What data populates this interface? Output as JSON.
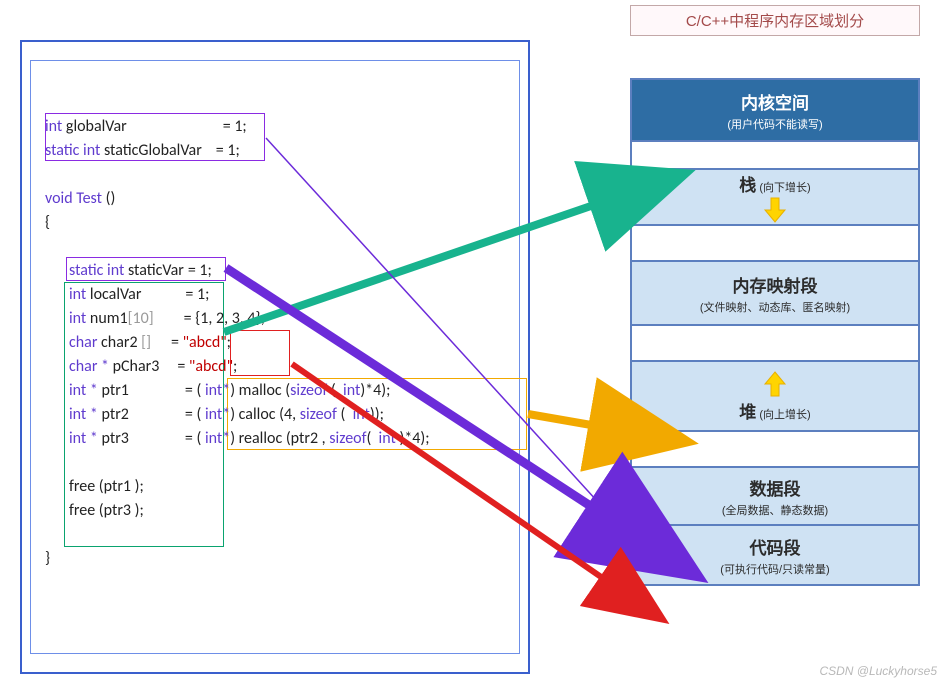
{
  "title": "C/C++中程序内存区域划分",
  "code": {
    "l1_kw": "int",
    "l1_txt": " globalVar",
    "l1_eq": "= 1;",
    "l2_kw": "static int",
    "l2_txt": " staticGlobalVar",
    "l2_eq": "= 1;",
    "l4_kw": "void",
    "l4_fn": "Test",
    "l4_paren": " ()",
    "l5": "{",
    "l6_kw": "static int",
    "l6_txt": " staticVar",
    "l6_eq": "= 1;",
    "l7_kw": "int",
    "l7_txt": " localVar",
    "l7_eq": "= 1;",
    "l8_kw": "int",
    "l8_txt": " num1",
    "l8_idx": "[10]",
    "l8_eq": "= {1, 2, 3, 4};",
    "l9_kw": "char",
    "l9_txt": " char2",
    "l9_idx": " []",
    "l9_eq": "= ",
    "l9_str": "\"abcd\"",
    "l9_sc": ";",
    "l10_kw": "char *",
    "l10_txt": " pChar3",
    "l10_eq": "= ",
    "l10_str": "\"abcd\"",
    "l10_sc": ";",
    "l11_kw": "int *",
    "l11_txt": " ptr1",
    "l11_eq": "= ( ",
    "l11_cast": "int*",
    "l11_call": ") malloc (",
    "l11_size": "sizeof",
    "l11_rest": " ( ",
    "l11_int": " int",
    "l11_p2": ")*4);",
    "l12_kw": "int *",
    "l12_txt": " ptr2",
    "l12_eq": "= ( ",
    "l12_cast": "int*",
    "l12_call": ") calloc (4, ",
    "l12_size": "sizeof",
    "l12_rest": " ( ",
    "l12_int": " int",
    "l12_p2": "));",
    "l13_kw": "int *",
    "l13_txt": " ptr3",
    "l13_eq": "= ( ",
    "l13_cast": "int*",
    "l13_call": ") realloc (ptr2 , ",
    "l13_size": "sizeof",
    "l13_rest": "( ",
    "l13_int": " int",
    "l13_p2": " )*4);",
    "l15": "free (ptr1 );",
    "l16": "free (ptr3 );",
    "l17": "}"
  },
  "memory": {
    "r0_t": "内核空间",
    "r0_s": "(用户代码不能读写)",
    "r1_t": "栈",
    "r1_s": " (向下增长)",
    "r2_t": "内存映射段",
    "r2_s": "(文件映射、动态库、匿名映射)",
    "r3_t": "堆",
    "r3_s": " (向上增长)",
    "r4_t": "数据段",
    "r4_s": "(全局数据、静态数据)",
    "r5_t": "代码段",
    "r5_s": "(可执行代码/只读常量)"
  },
  "watermark": "CSDN @Luckyhorse5"
}
